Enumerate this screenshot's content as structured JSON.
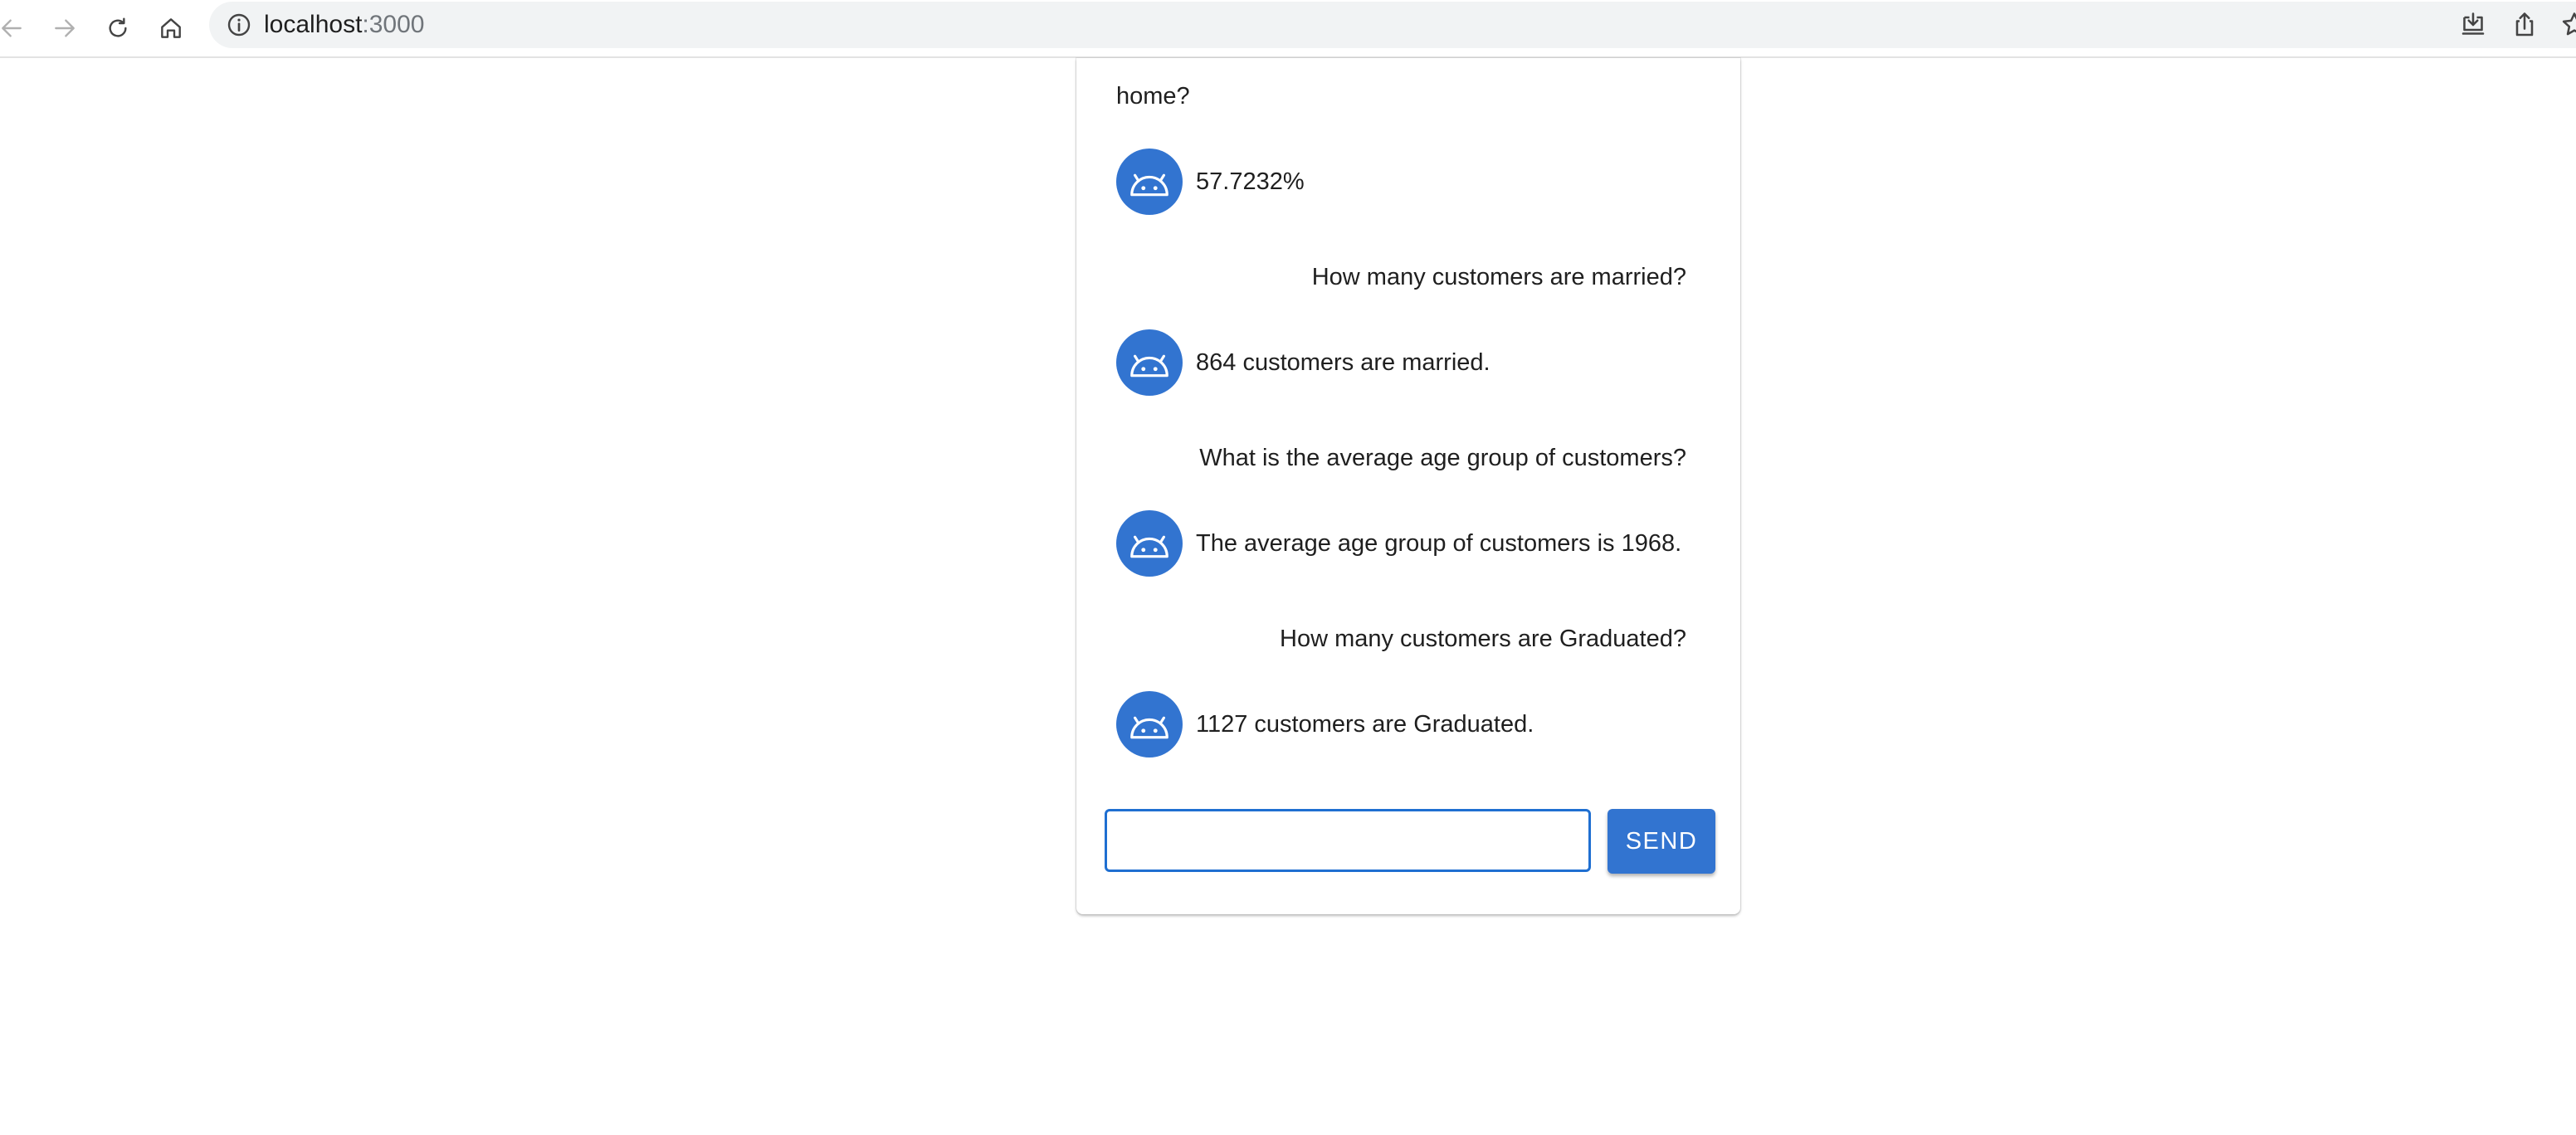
{
  "browser": {
    "url_host": "localhost",
    "url_port": ":3000"
  },
  "chat": {
    "partial_user_message": "home?",
    "messages": [
      {
        "bot": "57.7232%"
      },
      {
        "user": "How many customers are married?",
        "bot": "864 customers are married."
      },
      {
        "user": "What is the average age group of customers?",
        "bot": "The average age group of customers is 1968."
      },
      {
        "user": "How many customers are Graduated?",
        "bot": "1127 customers are Graduated."
      }
    ],
    "input_value": "",
    "send_label": "SEND"
  },
  "colors": {
    "accent": "#3274d0",
    "input_border": "#1f6fd1"
  },
  "icons": {
    "avatar": "android-robot-icon",
    "back": "back-arrow-icon",
    "forward": "forward-arrow-icon",
    "reload": "reload-icon",
    "home": "home-icon",
    "info": "info-icon",
    "install": "install-app-icon",
    "share": "share-icon"
  }
}
